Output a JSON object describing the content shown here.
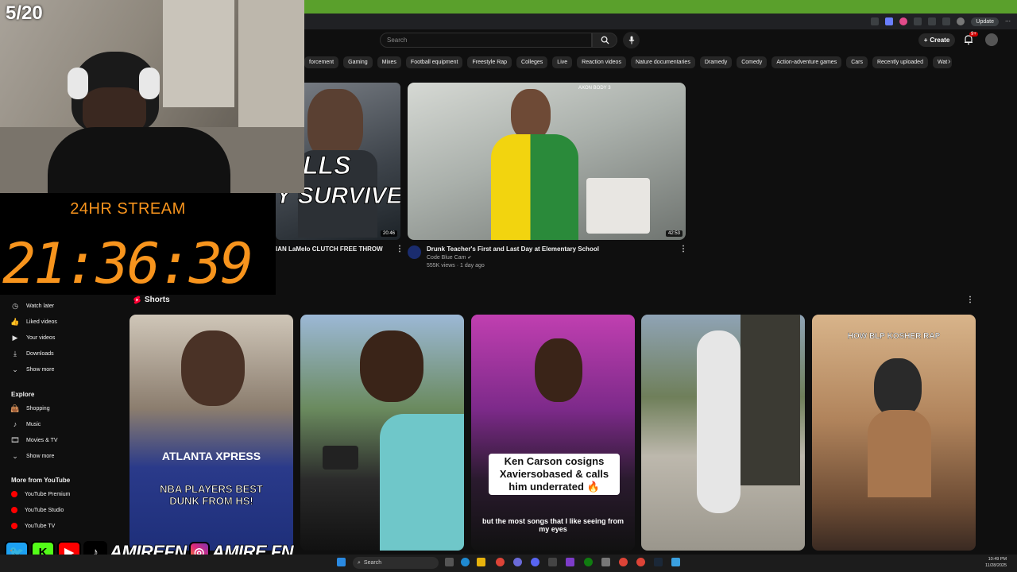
{
  "browser": {
    "update_label": "Update"
  },
  "header": {
    "search_placeholder": "Search",
    "create_label": "Create",
    "notif_count": "9+"
  },
  "chips": [
    "forcement",
    "Gaming",
    "Mixes",
    "Football equipment",
    "Freestyle Rap",
    "Colleges",
    "Live",
    "Reaction videos",
    "Nature documentaries",
    "Dramedy",
    "Comedy",
    "Action-adventure games",
    "Cars",
    "Recently uploaded",
    "Wat"
  ],
  "videos": [
    {
      "title": "IAN LaMelo CLUTCH FREE THROW +",
      "duration": "20:46",
      "thumb_text_1": "HILLS",
      "thumb_text_2": "Y SURVIVES!"
    },
    {
      "title": "Drunk Teacher's First and Last Day at Elementary School",
      "channel": "Code Blue Cam",
      "meta": "555K views · 1 day ago",
      "duration": "42:53"
    }
  ],
  "stream": {
    "counter": "5/20",
    "label": "24HR STREAM",
    "timer": "21:36:39"
  },
  "sidebar": {
    "you_items": [
      {
        "label": "Watch later",
        "icon": "clock-icon"
      },
      {
        "label": "Liked videos",
        "icon": "thumbs-up-icon"
      },
      {
        "label": "Your videos",
        "icon": "play-square-icon"
      },
      {
        "label": "Downloads",
        "icon": "download-icon"
      },
      {
        "label": "Show more",
        "icon": "chevron-down-icon"
      }
    ],
    "explore_heading": "Explore",
    "explore_items": [
      {
        "label": "Shopping",
        "icon": "bag-icon"
      },
      {
        "label": "Music",
        "icon": "music-icon"
      },
      {
        "label": "Movies & TV",
        "icon": "film-icon"
      },
      {
        "label": "Show more",
        "icon": "chevron-down-icon"
      }
    ],
    "more_heading": "More from YouTube",
    "more_items": [
      {
        "label": "YouTube Premium"
      },
      {
        "label": "YouTube Studio"
      },
      {
        "label": "YouTube TV"
      }
    ]
  },
  "shorts": {
    "heading": "Shorts",
    "items": [
      {
        "caption": "NBA PLAYERS BEST DUNK FROM HS!",
        "jersey": "ATLANTA XPRESS"
      },
      {
        "caption": ""
      },
      {
        "caption": "Ken Carson cosigns Xaviersobased & calls him underrated 🔥",
        "sub": "but the most songs that I like seeing from my eyes"
      },
      {
        "caption": ""
      },
      {
        "caption": "HOW BLP KOSHER RAP"
      }
    ]
  },
  "taskbar": {
    "search_label": "Search",
    "time": "10:49 PM",
    "date": "11/28/2025"
  },
  "social": {
    "handle1": "AMIREFN",
    "handle2": "AMIRE.FN"
  },
  "colors": {
    "accent_orange": "#f7941d",
    "bg": "#0f0f0f",
    "youtube_red": "#ff0000"
  }
}
